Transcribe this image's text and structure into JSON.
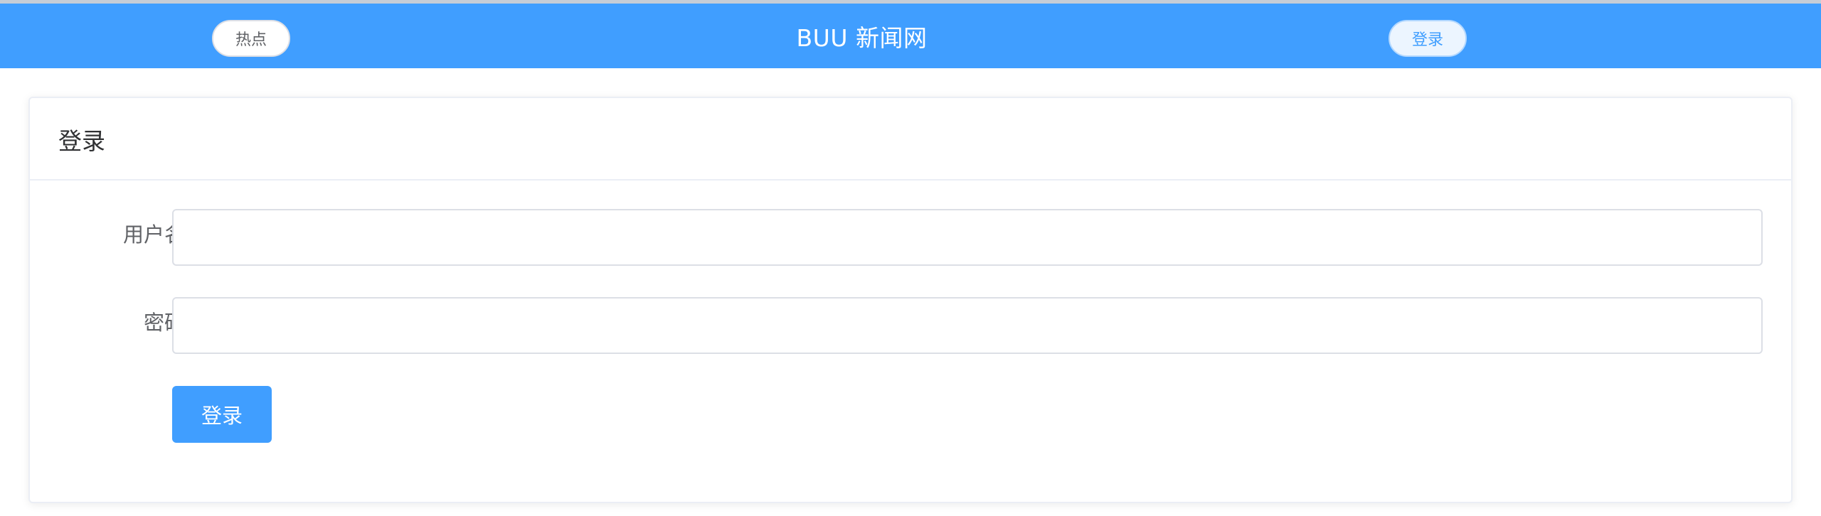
{
  "header": {
    "hot_label": "热点",
    "site_title": "BUU 新闻网",
    "login_label": "登录",
    "background_color": "#409eff"
  },
  "login_card": {
    "title": "登录",
    "username_label": "用户名",
    "username_value": "",
    "password_label": "密码",
    "password_value": "",
    "submit_label": "登录"
  }
}
